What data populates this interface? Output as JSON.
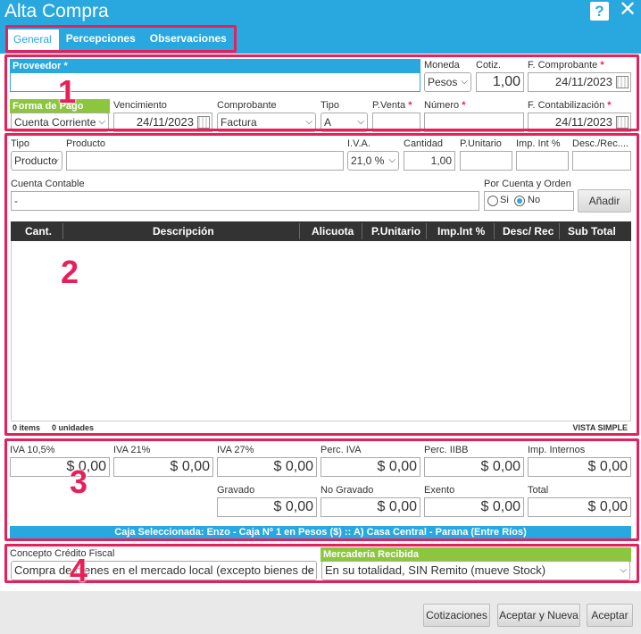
{
  "window": {
    "title": "Alta Compra",
    "help": "?",
    "close": "✕"
  },
  "tabs": [
    {
      "label": "General"
    },
    {
      "label": "Percepciones"
    },
    {
      "label": "Observaciones"
    }
  ],
  "markers": [
    "1",
    "2",
    "3",
    "4"
  ],
  "header": {
    "proveedor_label": "Proveedor",
    "proveedor_value": "",
    "moneda_label": "Moneda",
    "moneda_value": "Pesos",
    "cotiz_label": "Cotiz.",
    "cotiz_value": "1,00",
    "fcomprobante_label": "F. Comprobante",
    "fcomprobante_value": "24/11/2023",
    "formapago_label": "Forma de Pago",
    "formapago_value": "Cuenta Corriente",
    "vencimiento_label": "Vencimiento",
    "vencimiento_value": "24/11/2023",
    "comprobante_label": "Comprobante",
    "comprobante_value": "Factura",
    "tipo_label": "Tipo",
    "tipo_value": "A",
    "pventa_label": "P.Venta",
    "pventa_value": "",
    "numero_label": "Número",
    "numero_value": "",
    "fcontab_label": "F. Contabilización",
    "fcontab_value": "24/11/2023",
    "required_mark": "*"
  },
  "item": {
    "tipo_label": "Tipo",
    "tipo_value": "Producto",
    "producto_label": "Producto",
    "producto_value": "",
    "iva_label": "I.V.A.",
    "iva_value": "21,0 %",
    "cantidad_label": "Cantidad",
    "cantidad_value": "1,00",
    "punitario_label": "P.Unitario",
    "punitario_value": "",
    "impint_label": "Imp. Int %",
    "impint_value": "",
    "descrec_label": "Desc./Rec....",
    "descrec_value": "",
    "cuenta_label": "Cuenta Contable",
    "cuenta_value": "-",
    "pco_label": "Por Cuenta y Orden",
    "pco_si": "Si",
    "pco_no": "No",
    "add_button": "Añadir"
  },
  "grid": {
    "columns": [
      "Cant.",
      "Descripción",
      "Alicuota",
      "P.Unitario",
      "Imp.Int %",
      "Desc/ Rec",
      "Sub Total"
    ],
    "rows": [],
    "footer_items": "0 items",
    "footer_units": "0 unidades",
    "view_mode": "VISTA SIMPLE"
  },
  "totals": {
    "iva105_label": "IVA 10,5%",
    "iva105_value": "$ 0,00",
    "iva21_label": "IVA 21%",
    "iva21_value": "$ 0,00",
    "iva27_label": "IVA 27%",
    "iva27_value": "$ 0,00",
    "perciva_label": "Perc. IVA",
    "perciva_value": "$ 0,00",
    "perciibb_label": "Perc. IIBB",
    "perciibb_value": "$ 0,00",
    "impint_label": "Imp. Internos",
    "impint_value": "$ 0,00",
    "gravado_label": "Gravado",
    "gravado_value": "$ 0,00",
    "nogravado_label": "No Gravado",
    "nogravado_value": "$ 0,00",
    "exento_label": "Exento",
    "exento_value": "$ 0,00",
    "total_label": "Total",
    "total_value": "$ 0,00",
    "caja": "Caja Seleccionada: Enzo - Caja Nº 1 en Pesos ($) :: A) Casa Central - Parana (Entre Ríos)"
  },
  "fiscal": {
    "concepto_label": "Concepto Crédito Fiscal",
    "concepto_value": "Compra de bienes en el mercado local (excepto bienes de uso)",
    "mercaderia_label": "Mercadería Recibida",
    "mercaderia_value": "En su totalidad, SIN Remito (mueve Stock)"
  },
  "buttons": {
    "cotizaciones": "Cotizaciones",
    "aceptar_nueva": "Aceptar y Nueva",
    "aceptar": "Aceptar"
  },
  "colors": {
    "accent": "#29a8e0",
    "highlight": "#e6205a",
    "green": "#8cc63f",
    "grid_header": "#333333"
  }
}
